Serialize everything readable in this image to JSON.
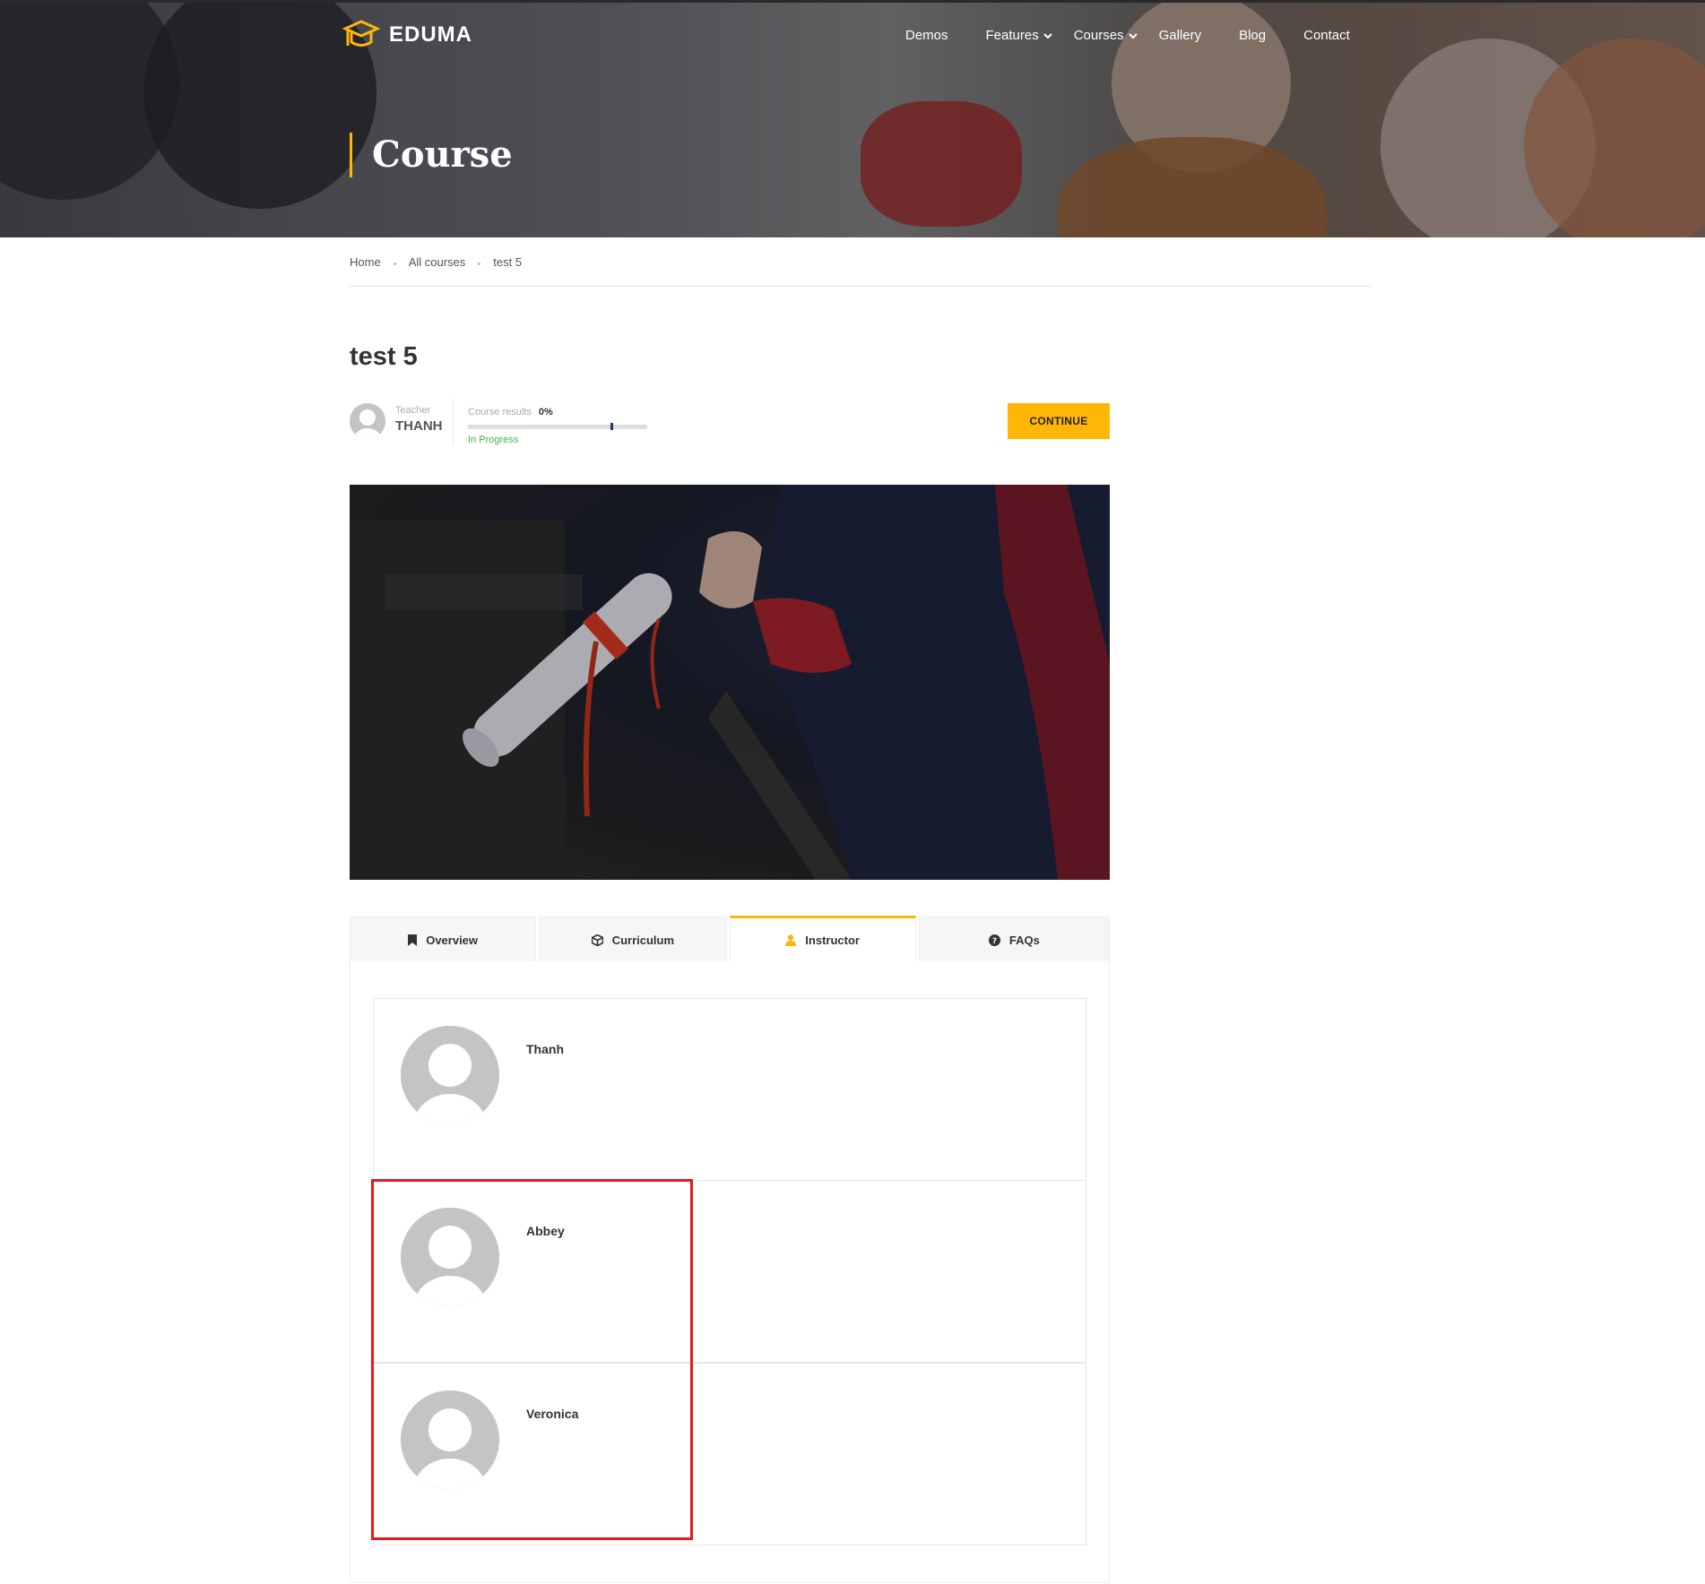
{
  "header": {
    "logo_text": "EDUMA",
    "title": "Course",
    "nav": [
      {
        "label": "Demos",
        "has_dropdown": false
      },
      {
        "label": "Features",
        "has_dropdown": true
      },
      {
        "label": "Courses",
        "has_dropdown": true
      },
      {
        "label": "Gallery",
        "has_dropdown": false
      },
      {
        "label": "Blog",
        "has_dropdown": false
      },
      {
        "label": "Contact",
        "has_dropdown": false
      }
    ]
  },
  "breadcrumb": [
    "Home",
    "All courses",
    "test 5"
  ],
  "course": {
    "title": "test 5",
    "teacher_label": "Teacher",
    "teacher_name": "THANH",
    "results_label": "Course results",
    "results_value": "0%",
    "progress_fraction": 0,
    "status": "In Progress",
    "continue_label": "CONTINUE"
  },
  "tabs": [
    {
      "label": "Overview",
      "icon": "bookmark-icon"
    },
    {
      "label": "Curriculum",
      "icon": "cube-icon"
    },
    {
      "label": "Instructor",
      "icon": "user-icon",
      "active": true
    },
    {
      "label": "FAQs",
      "icon": "question-circle-icon"
    }
  ],
  "instructors": [
    {
      "name": "Thanh"
    },
    {
      "name": "Abbey"
    },
    {
      "name": "Veronica"
    }
  ],
  "colors": {
    "accent": "#ffb606",
    "status_green": "#3ab54a",
    "highlight_red": "#e6191f"
  }
}
